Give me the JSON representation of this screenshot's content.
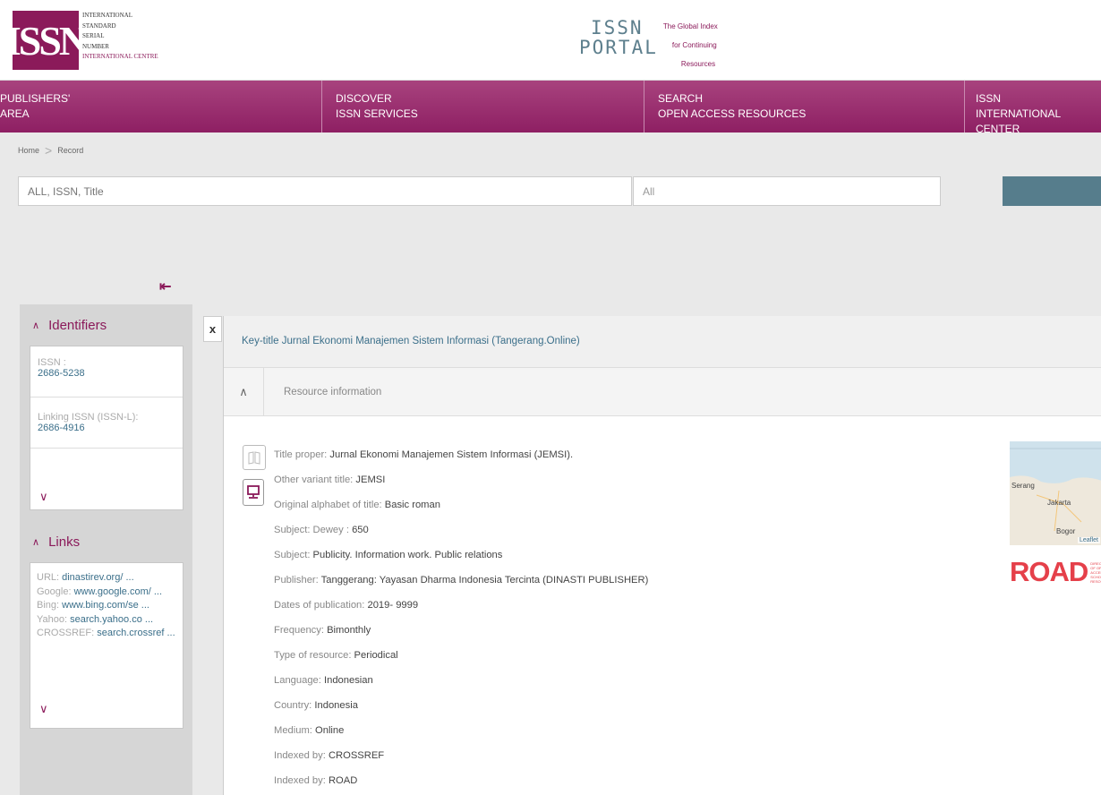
{
  "header": {
    "logo_text": "ISSN",
    "logo_lines": [
      "INTERNATIONAL",
      "STANDARD",
      "SERIAL",
      "NUMBER",
      "INTERNATIONAL CENTRE"
    ],
    "portal_title_1": "ISSN",
    "portal_title_2": "PORTAL",
    "portal_sub": [
      "The Global Index",
      "for Continuing",
      "Resources"
    ]
  },
  "nav": {
    "items": [
      {
        "line1": "PUBLISHERS'",
        "line2": "AREA"
      },
      {
        "line1": "DISCOVER",
        "line2": "ISSN SERVICES"
      },
      {
        "line1": "SEARCH",
        "line2": "OPEN ACCESS RESOURCES"
      },
      {
        "line1": "ISSN",
        "line2": "INTERNATIONAL CENTER"
      }
    ]
  },
  "breadcrumb": {
    "home": "Home",
    "sep": ">",
    "current": "Record"
  },
  "search": {
    "placeholder": "ALL, ISSN, Title",
    "select_value": "All"
  },
  "sidebar": {
    "identifiers": {
      "title": "Identifiers",
      "issn_label": "ISSN :",
      "issn_value": "2686-5238",
      "linking_label": "Linking ISSN (ISSN-L):",
      "linking_value": "2686-4916"
    },
    "links": {
      "title": "Links",
      "items": [
        {
          "label": "URL: ",
          "value": "dinastirev.org/ ..."
        },
        {
          "label": "Google: ",
          "value": "www.google.com/ ..."
        },
        {
          "label": "Bing: ",
          "value": "www.bing.com/se ..."
        },
        {
          "label": "Yahoo: ",
          "value": "search.yahoo.co ..."
        },
        {
          "label": "CROSSREF: ",
          "value": "search.crossref ..."
        }
      ]
    }
  },
  "main": {
    "close": "x",
    "keytitle": "Key-title Jurnal Ekonomi Manajemen Sistem Informasi (Tangerang.Online)",
    "resource_label": "Resource information",
    "records": [
      {
        "label": "Title proper: ",
        "value": "Jurnal Ekonomi Manajemen Sistem Informasi (JEMSI)."
      },
      {
        "label": "Other variant title: ",
        "value": "JEMSI"
      },
      {
        "label": "Original alphabet of title: ",
        "value": "Basic roman"
      },
      {
        "label": "Subject: Dewey : ",
        "value": "650"
      },
      {
        "label": "Subject: ",
        "value": "Publicity. Information work. Public relations"
      },
      {
        "label": "Publisher: ",
        "value": "Tanggerang: Yayasan Dharma Indonesia Tercinta (DINASTI PUBLISHER)"
      },
      {
        "label": "Dates of publication: ",
        "value": "2019- 9999"
      },
      {
        "label": "Frequency: ",
        "value": "Bimonthly"
      },
      {
        "label": "Type of resource: ",
        "value": "Periodical"
      },
      {
        "label": "Language: ",
        "value": "Indonesian"
      },
      {
        "label": "Country: ",
        "value": "Indonesia"
      },
      {
        "label": "Medium: ",
        "value": "Online"
      },
      {
        "label": "Indexed by: ",
        "value": "CROSSREF"
      },
      {
        "label": "Indexed by: ",
        "value": "ROAD"
      }
    ],
    "map": {
      "labels": [
        "Serang",
        "Jakarta",
        "Bogor"
      ],
      "attribution": "Leaflet"
    },
    "road": {
      "text": "ROAD",
      "sub": "DIRECTORY OF OPEN ACCESS SCHOLARLY RESOURCES"
    }
  },
  "colors": {
    "brand": "#8b1a5a",
    "accent": "#567d8c",
    "link": "#3b6f8a"
  }
}
